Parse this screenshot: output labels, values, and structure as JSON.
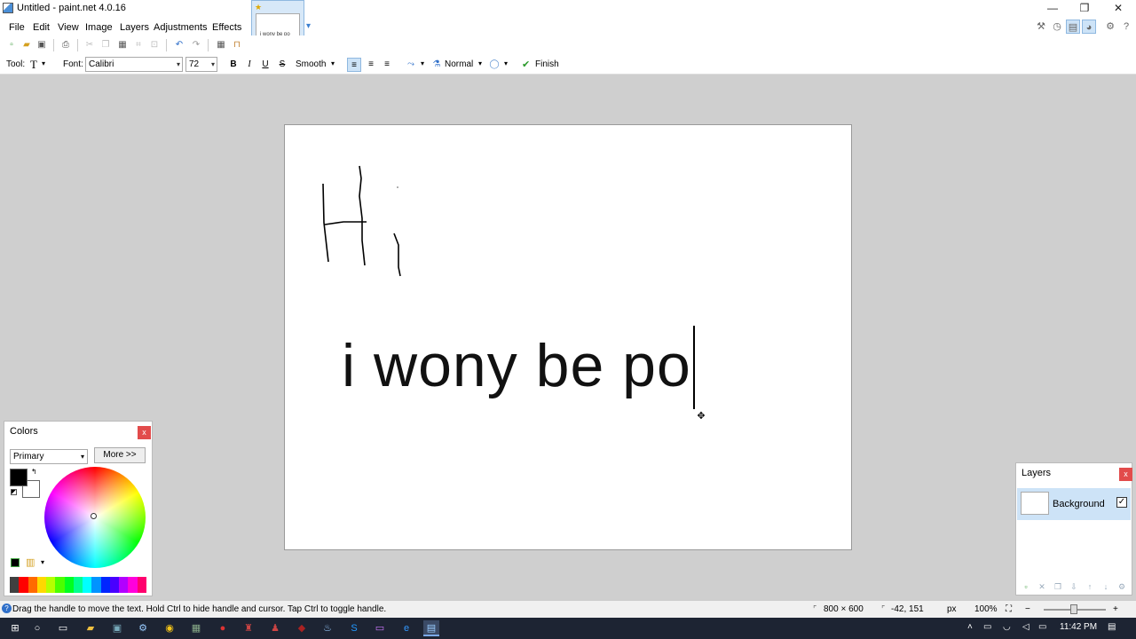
{
  "window": {
    "title": "Untitled - paint.net 4.0.16",
    "minimize": "—",
    "restore": "❐",
    "close": "✕"
  },
  "menu": [
    "File",
    "Edit",
    "View",
    "Image",
    "Layers",
    "Adjustments",
    "Effects"
  ],
  "thumbnail_tab": {
    "label": "i wony be po",
    "star": "★"
  },
  "options": {
    "tool_label": "Tool:",
    "tool_value": "T",
    "font_label": "Font:",
    "font_value": "Calibri",
    "size_value": "72",
    "bold": "B",
    "italic": "I",
    "underline": "U",
    "strike": "S",
    "rendering": "Smooth",
    "blend_mode": "Normal",
    "finish": "Finish",
    "finish_icon": "✔"
  },
  "canvas": {
    "text": "i wony be po",
    "handle_icon": "✥"
  },
  "colors_panel": {
    "title": "Colors",
    "close": "x",
    "mode": "Primary",
    "more": "More >>",
    "primary_color": "#000000",
    "secondary_color": "#ffffff",
    "palette": [
      "#404040",
      "#ff0000",
      "#ff6a00",
      "#ffd800",
      "#b6ff00",
      "#4cff00",
      "#00ff21",
      "#00ff90",
      "#00ffff",
      "#0094ff",
      "#0026ff",
      "#4800ff",
      "#b200ff",
      "#ff00dc",
      "#ff006e"
    ]
  },
  "layers_panel": {
    "title": "Layers",
    "close": "x",
    "layer_name": "Background",
    "checked": "✓"
  },
  "status": {
    "help_icon": "?",
    "message": "Drag the handle to move the text. Hold Ctrl to hide handle and cursor. Tap Ctrl to toggle handle.",
    "image_size": "800 × 600",
    "cursor_pos": "-42, 151",
    "units": "px",
    "zoom": "100%"
  },
  "taskbar": {
    "time": "11:42 PM"
  }
}
